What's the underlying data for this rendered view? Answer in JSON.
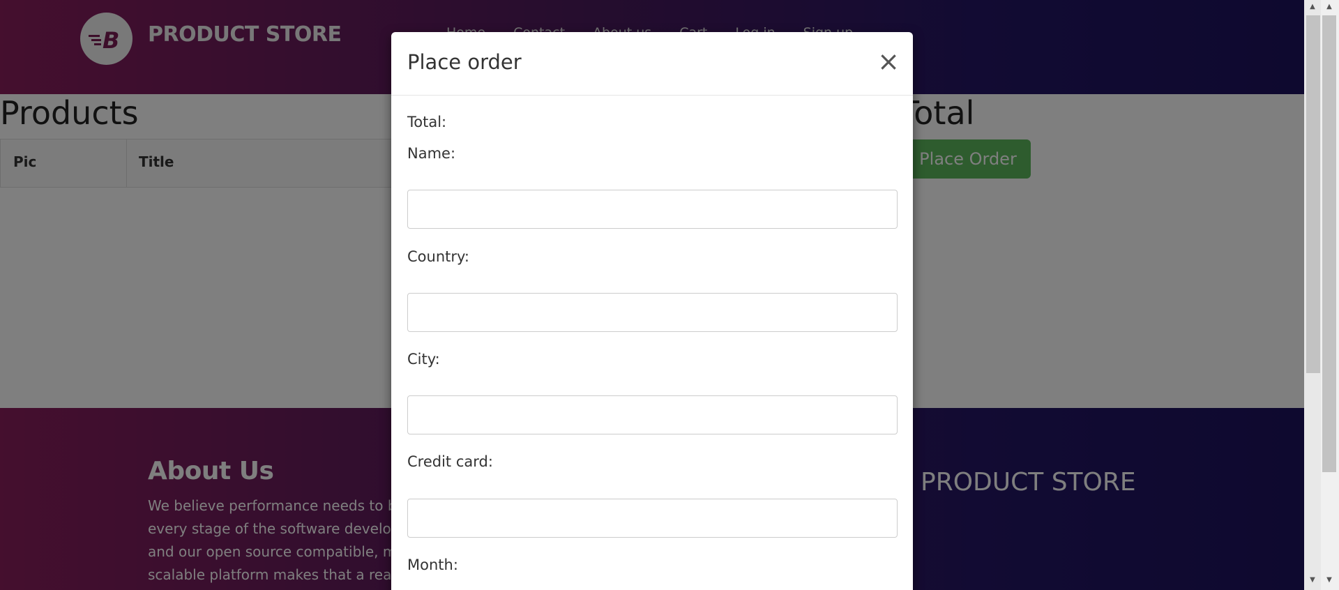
{
  "navbar": {
    "brand": "PRODUCT STORE",
    "logo_icon": "store-logo-icon",
    "links": [
      "Home",
      "Contact",
      "About us",
      "Cart",
      "Log in",
      "Sign up"
    ]
  },
  "content": {
    "products_heading": "Products",
    "table_headers": [
      "Pic",
      "Title"
    ],
    "total_heading": "Total",
    "place_order_label": "Place Order"
  },
  "footer": {
    "about_title": "About Us",
    "about_text": "We believe performance needs to be validated at every stage of the software development cycle and our open source compatible, massively scalable platform makes that a reality.",
    "brand": "PRODUCT STORE"
  },
  "modal": {
    "title": "Place order",
    "close_label": "×",
    "total_label": "Total:",
    "fields": [
      {
        "label": "Name:",
        "value": ""
      },
      {
        "label": "Country:",
        "value": ""
      },
      {
        "label": "City:",
        "value": ""
      },
      {
        "label": "Credit card:",
        "value": ""
      },
      {
        "label": "Month:",
        "value": ""
      }
    ]
  },
  "colors": {
    "accent_green": "#5cb85c",
    "gradient_start": "#8a1e5d",
    "gradient_end": "#1d125e"
  }
}
